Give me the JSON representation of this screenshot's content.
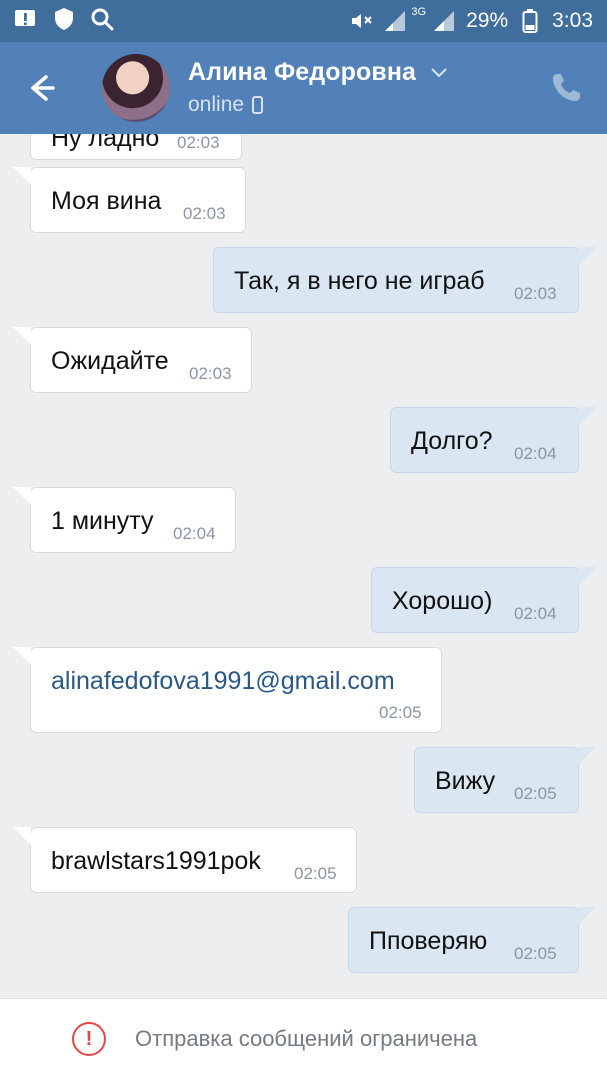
{
  "status_bar": {
    "battery_percent": "29%",
    "time": "3:03",
    "network": "3G"
  },
  "header": {
    "contact_name": "Алина Федоровна",
    "presence": "online"
  },
  "messages": [
    {
      "text": "Ну ладно",
      "time": "02:03",
      "direction": "in"
    },
    {
      "text": "Моя вина",
      "time": "02:03",
      "direction": "in"
    },
    {
      "text": "Так, я в него не играб",
      "time": "02:03",
      "direction": "out"
    },
    {
      "text": "Ожидайте",
      "time": "02:03",
      "direction": "in"
    },
    {
      "text": "Долго?",
      "time": "02:04",
      "direction": "out"
    },
    {
      "text": "1 минуту",
      "time": "02:04",
      "direction": "in"
    },
    {
      "text": "Хорошо)",
      "time": "02:04",
      "direction": "out"
    },
    {
      "text": "alinafedofova1991@gmail.com",
      "time": "02:05",
      "direction": "in"
    },
    {
      "text": "Вижу",
      "time": "02:05",
      "direction": "out"
    },
    {
      "text": "brawlstars1991pok",
      "time": "02:05",
      "direction": "in"
    },
    {
      "text": "Пповеряю",
      "time": "02:05",
      "direction": "out"
    }
  ],
  "footer": {
    "notice": "Отправка сообщений ограничена"
  },
  "colors": {
    "statusbar": "#3f6d9c",
    "header": "#5181b8",
    "incoming_bubble": "#ffffff",
    "outgoing_bubble": "#dbe6f3",
    "link": "#2a5885",
    "warning": "#e64646"
  },
  "icons": {
    "statusbar_left": [
      "notification-alert-icon",
      "shield-icon",
      "search-icon"
    ],
    "statusbar_right": [
      "mute-icon",
      "signal-icon",
      "network-icon",
      "battery-icon"
    ],
    "header": [
      "back-arrow-icon",
      "chevron-down-icon",
      "mobile-device-icon",
      "phone-call-icon"
    ],
    "footer": [
      "warning-icon"
    ]
  }
}
